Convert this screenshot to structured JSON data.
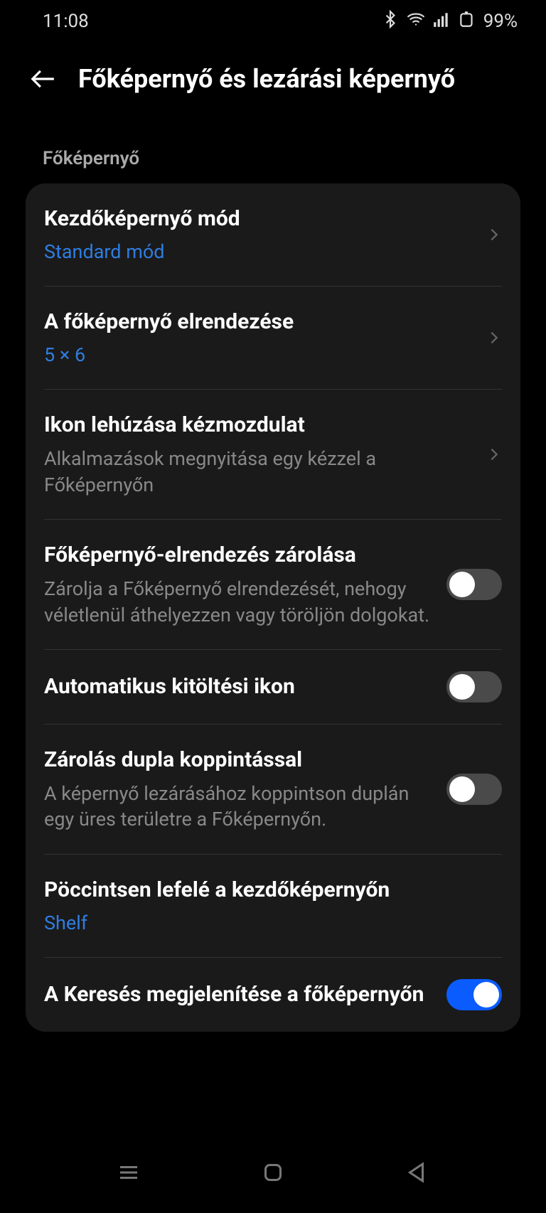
{
  "status": {
    "time": "11:08",
    "battery": "99%"
  },
  "header": {
    "title": "Főképernyő és lezárási képernyő"
  },
  "section": {
    "label": "Főképernyő"
  },
  "rows": {
    "mode": {
      "title": "Kezdőképernyő mód",
      "value": "Standard mód"
    },
    "layout": {
      "title": "A főképernyő elrendezése",
      "value": "5 × 6"
    },
    "pulldown": {
      "title": "Ikon lehúzása kézmozdulat",
      "desc": "Alkalmazások megnyitása egy kézzel a Főképernyőn"
    },
    "lock_layout": {
      "title": "Főképernyő-elrendezés zárolása",
      "desc": "Zárolja a Főképernyő elrendezését, nehogy véletlenül áthelyezzen vagy töröljön dolgokat.",
      "on": false
    },
    "autofill": {
      "title": "Automatikus kitöltési ikon",
      "on": false
    },
    "doubletap": {
      "title": "Zárolás dupla koppintással",
      "desc": "A képernyő lezárásához koppintson duplán egy üres területre a Főképernyőn.",
      "on": false
    },
    "swipedown": {
      "title": "Pöccintsen lefelé a kezdőképernyőn",
      "value": "Shelf"
    },
    "search": {
      "title": "A Keresés megjelenítése a főképernyőn",
      "on": true
    }
  }
}
